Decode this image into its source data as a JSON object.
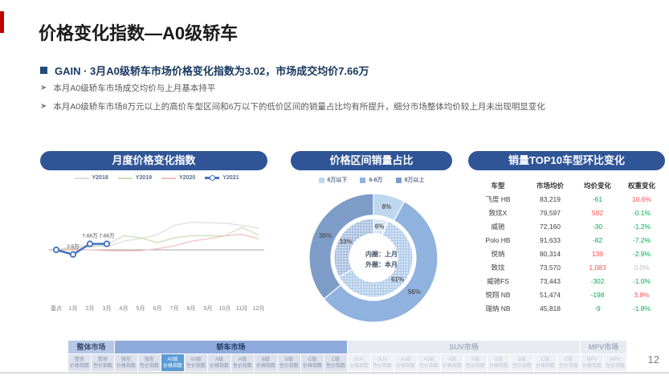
{
  "slide": {
    "title": "价格变化指数—A0级轿车",
    "subtitle": "GAIN · 3月A0级轿车市场价格变化指数为3.02，市场成交均价7.66万",
    "bullets": [
      "本月A0级轿车市场成交均价与上月基本持平",
      "本月A0级轿车市场8万元以上的高价车型区间和6万以下的低价区间的销量占比均有所提升，细分市场整体均价较上月未出现明显变化"
    ],
    "page_number": "12"
  },
  "panels": {
    "line_panel_title": "月度价格变化指数",
    "donut_panel_title": "价格区间销量占比",
    "table_panel_title": "销量TOP10车型环比变化"
  },
  "chart_data": [
    {
      "type": "line",
      "title": "月度价格变化指数",
      "x": [
        "基点",
        "1月",
        "2月",
        "3月",
        "4月",
        "5月",
        "6月",
        "7月",
        "8月",
        "9月",
        "10月",
        "11月",
        "12月"
      ],
      "series": [
        {
          "name": "Y2018",
          "color": "#DDDDDD",
          "marker": false,
          "values": [
            0,
            1.7,
            2.4,
            1.5,
            4.3,
            5.6,
            7.5,
            12.2,
            13.7,
            13.5,
            13.3,
            12.2,
            10.8
          ]
        },
        {
          "name": "Y2019",
          "color": "#C6E0B4",
          "marker": false,
          "values": [
            0,
            0.8,
            1.5,
            2.5,
            7,
            6,
            3.6,
            6,
            7,
            7,
            7,
            11.2,
            7.5
          ]
        },
        {
          "name": "Y2020",
          "color": "#F5BFBF",
          "marker": false,
          "values": [
            0,
            0.3,
            0,
            -0.4,
            -0.5,
            -0.4,
            0.5,
            2,
            4.3,
            5.5,
            7,
            7.8,
            5.5
          ]
        },
        {
          "name": "Y2021",
          "color": "#4472C4",
          "marker": true,
          "values": [
            0,
            -2.3,
            3.0,
            3.02,
            null,
            null,
            null,
            null,
            null,
            null,
            null,
            null,
            null
          ]
        }
      ],
      "point_labels": [
        {
          "x_index": 1,
          "text": "7.5万"
        },
        {
          "x_index": 2,
          "text": "7.66万"
        },
        {
          "x_index": 3,
          "text": "7.66万"
        }
      ],
      "baseline_value": 0,
      "y_axis_visible": false,
      "ylim": [
        -27,
        18
      ],
      "legend_position": "top"
    },
    {
      "type": "pie",
      "title": "价格区间销量占比",
      "legend": [
        "6万以下",
        "6-8万",
        "8万以上"
      ],
      "colors": [
        "#BDD7EE",
        "#8FB2DE",
        "#7D9CC8"
      ],
      "inner_colors": [
        "#D8E6F5",
        "#B3CDEC",
        "#A9C0E0"
      ],
      "rings": [
        {
          "name": "本月",
          "position": "outer",
          "values": [
            8,
            56,
            36
          ]
        },
        {
          "name": "上月",
          "position": "inner",
          "values": [
            6,
            61,
            33
          ]
        }
      ],
      "center_labels": [
        "内圈：上月",
        "外圈：本月"
      ]
    }
  ],
  "table": {
    "headers": [
      "车型",
      "市场均价",
      "均价变化",
      "权重变化"
    ],
    "rows": [
      [
        "飞度 HB",
        "83,219",
        "-61",
        "10.6%"
      ],
      [
        "致炫X",
        "79,597",
        "502",
        "-0.1%"
      ],
      [
        "威驰",
        "72,160",
        "-30",
        "-1.2%"
      ],
      [
        "Polo HB",
        "91,633",
        "-82",
        "-7.2%"
      ],
      [
        "悦纳",
        "80,314",
        "139",
        "-2.9%"
      ],
      [
        "致炫",
        "73,570",
        "1,083",
        "0.0%"
      ],
      [
        "威驰FS",
        "73,443",
        "-302",
        "-1.0%"
      ],
      [
        "悦翔 NB",
        "51,474",
        "-198",
        "3.8%"
      ],
      [
        "瑞纳 NB",
        "45,818",
        "-9",
        "-1.8%"
      ]
    ]
  },
  "bottom_nav": {
    "groups": [
      {
        "label": "整体市场",
        "tab_count": 2,
        "style": "light"
      },
      {
        "label": "轿车市场",
        "tab_count": 10,
        "style": "medium"
      },
      {
        "label": "SUV市场",
        "tab_count": 10,
        "style": "dim"
      },
      {
        "label": "MPV市场",
        "tab_count": 2,
        "style": "dim"
      }
    ],
    "tabs": [
      {
        "seg": "整体",
        "type": "价格指数",
        "state": "normal"
      },
      {
        "seg": "整体",
        "type": "性价指数",
        "state": "normal"
      },
      {
        "seg": "微型",
        "type": "价格指数",
        "state": "normal"
      },
      {
        "seg": "微型",
        "type": "性价指数",
        "state": "normal"
      },
      {
        "seg": "A0级",
        "type": "价格指数",
        "state": "active"
      },
      {
        "seg": "A0级",
        "type": "性价指数",
        "state": "normal"
      },
      {
        "seg": "A级",
        "type": "价格指数",
        "state": "normal"
      },
      {
        "seg": "A级",
        "type": "性价指数",
        "state": "normal"
      },
      {
        "seg": "B级",
        "type": "价格指数",
        "state": "normal"
      },
      {
        "seg": "B级",
        "type": "性价指数",
        "state": "normal"
      },
      {
        "seg": "C级",
        "type": "价格指数",
        "state": "normal"
      },
      {
        "seg": "C级",
        "type": "性价指数",
        "state": "normal"
      },
      {
        "seg": "SUV",
        "type": "价格指数",
        "state": "dim"
      },
      {
        "seg": "SUV",
        "type": "性价指数",
        "state": "dim"
      },
      {
        "seg": "A0级",
        "type": "价格指数",
        "state": "dim"
      },
      {
        "seg": "A0级",
        "type": "性价指数",
        "state": "dim"
      },
      {
        "seg": "A级",
        "type": "价格指数",
        "state": "dim"
      },
      {
        "seg": "A级",
        "type": "性价指数",
        "state": "dim"
      },
      {
        "seg": "B级",
        "type": "价格指数",
        "state": "dim"
      },
      {
        "seg": "B级",
        "type": "性价指数",
        "state": "dim"
      },
      {
        "seg": "C级",
        "type": "价格指数",
        "state": "dim"
      },
      {
        "seg": "C级",
        "type": "性价指数",
        "state": "dim"
      },
      {
        "seg": "MPV",
        "type": "价格指数",
        "state": "dim"
      },
      {
        "seg": "MPV",
        "type": "性价指数",
        "state": "dim"
      }
    ]
  },
  "colors": {
    "accent_red": "#C00000",
    "header_pill_blue": "#2F5597",
    "subtitle_navy": "#17375E",
    "active_tab_blue": "#5B9BD5",
    "positive_change_red": "#FF5050",
    "negative_change_green": "#00B050",
    "zero_change_gray": "#BFBFBF",
    "axis_gray": "#A6A6A6"
  }
}
